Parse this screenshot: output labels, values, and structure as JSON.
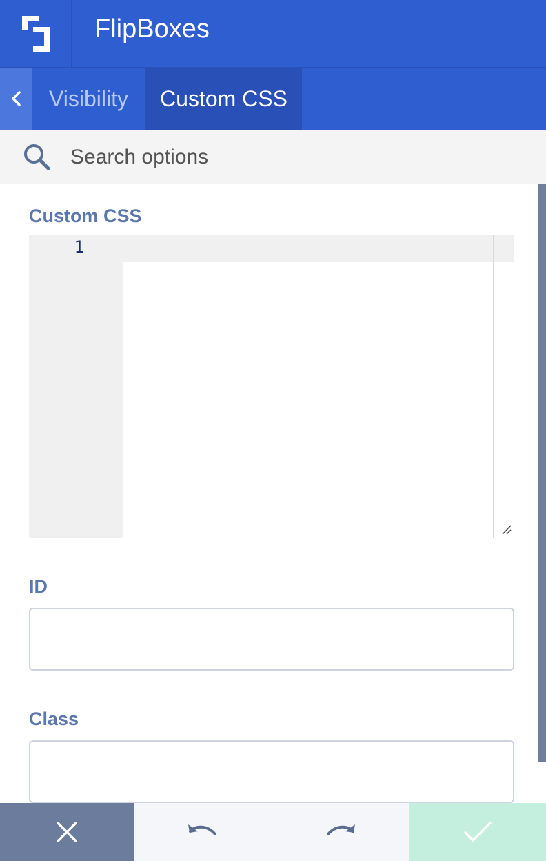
{
  "header": {
    "app_title": "FlipBoxes",
    "logo_icon": "builder-logo-icon",
    "bg_color": "#2f5ed1"
  },
  "tabs": {
    "back_icon": "chevron-left-icon",
    "items": [
      {
        "label": "Visibility",
        "active": false
      },
      {
        "label": "Custom CSS",
        "active": true
      }
    ]
  },
  "search": {
    "icon": "search-icon",
    "placeholder": "Search options",
    "value": ""
  },
  "fields": {
    "custom_css": {
      "label": "Custom CSS",
      "line_numbers": [
        "1"
      ],
      "value": ""
    },
    "id": {
      "label": "ID",
      "value": ""
    },
    "class": {
      "label": "Class",
      "value": ""
    }
  },
  "footer": {
    "close_icon": "close-icon",
    "undo_icon": "undo-icon",
    "redo_icon": "redo-icon",
    "save_icon": "checkmark-icon",
    "close_color": "#6b7c9d",
    "save_color": "#c4eedd"
  }
}
